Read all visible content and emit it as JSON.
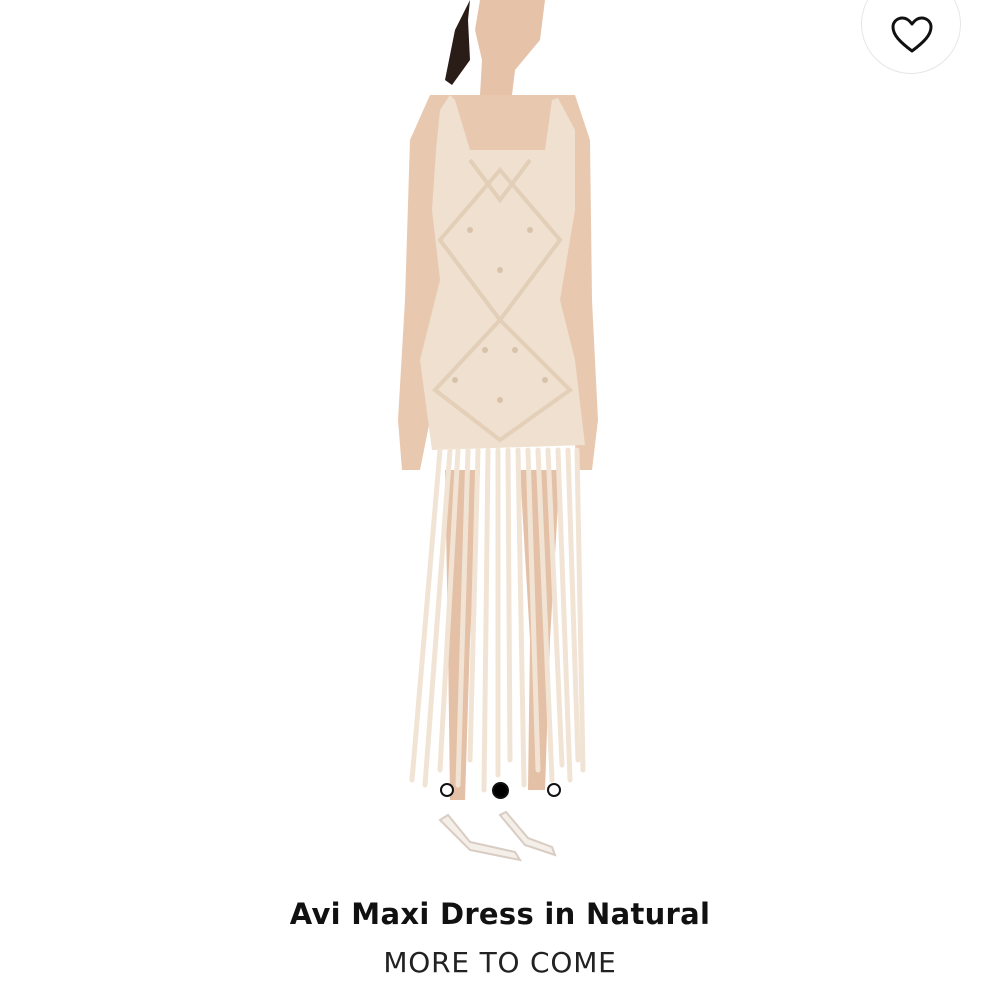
{
  "product": {
    "name": "Avi Maxi Dress in Natural",
    "status": "MORE TO COME"
  },
  "wishlist": {
    "icon": "heart-outline-icon"
  },
  "carousel": {
    "slide_count": 3,
    "active_index": 1
  },
  "colors": {
    "dress": "#efe0cf",
    "skin": "#e9c8b0",
    "hair": "#2a1d17",
    "dot_active": "#000000"
  }
}
